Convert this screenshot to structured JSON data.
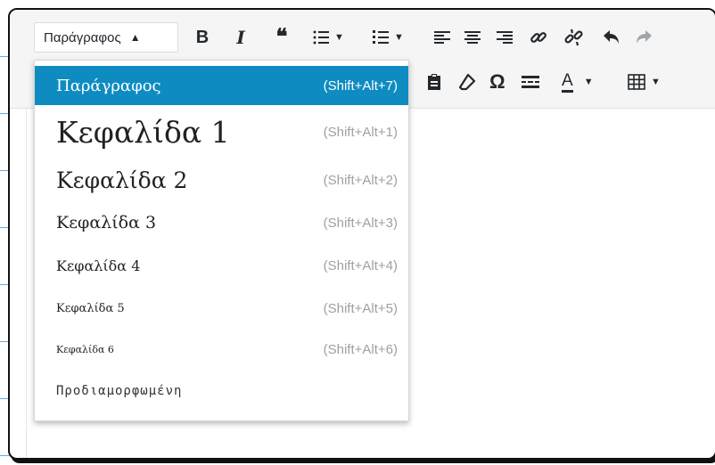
{
  "toolbar": {
    "format_select": {
      "value": "Παράγραφος",
      "arrow": "▲"
    },
    "row1": [
      {
        "name": "bold-button",
        "glyph": "B"
      },
      {
        "name": "italic-button",
        "glyph": "I"
      },
      {
        "name": "blockquote-button",
        "glyph": "❝"
      }
    ],
    "row2_special_char": "Ω",
    "text_color_letter": "A"
  },
  "format_dropdown": {
    "items": [
      {
        "label": "Παράγραφος",
        "shortcut": "(Shift+Alt+7)",
        "selected": true
      },
      {
        "label": "Κεφαλίδα 1",
        "shortcut": "(Shift+Alt+1)"
      },
      {
        "label": "Κεφαλίδα 2",
        "shortcut": "(Shift+Alt+2)"
      },
      {
        "label": "Κεφαλίδα 3",
        "shortcut": "(Shift+Alt+3)"
      },
      {
        "label": "Κεφαλίδα 4",
        "shortcut": "(Shift+Alt+4)"
      },
      {
        "label": "Κεφαλίδα 5",
        "shortcut": "(Shift+Alt+5)"
      },
      {
        "label": "Κεφαλίδα 6",
        "shortcut": "(Shift+Alt+6)"
      },
      {
        "label": "Προδιαμορφωμένη",
        "shortcut": ""
      }
    ]
  },
  "colors": {
    "selected_bg": "#0e8cc1",
    "toolbar_bg": "#f5f5f5",
    "icon": "#23282d"
  }
}
